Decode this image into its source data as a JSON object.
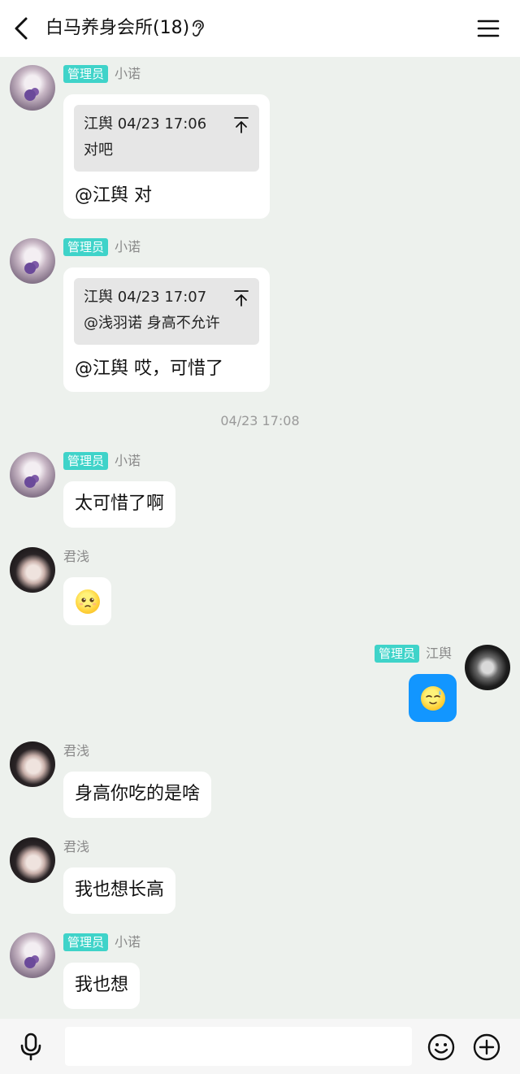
{
  "header": {
    "title": "白马养身会所(18)"
  },
  "badge_label": "管理员",
  "messages": [
    {
      "sender": "小诺",
      "quote_author": "江舆",
      "quote_time": "04/23 17:06",
      "quote_text": "对吧",
      "text": "@江舆 对"
    },
    {
      "sender": "小诺",
      "quote_author": "江舆",
      "quote_time": "04/23 17:07",
      "quote_text": "@浅羽诺 身高不允许",
      "text": "@江舆 哎，可惜了"
    },
    {
      "sender": "小诺",
      "text": "太可惜了啊"
    },
    {
      "sender": "君浅",
      "emoji": "pleading-face-icon"
    },
    {
      "sender": "江舆",
      "emoji": "sweat-smile-face-icon"
    },
    {
      "sender": "君浅",
      "text": "身高你吃的是啥"
    },
    {
      "sender": "君浅",
      "text": "我也想长高"
    },
    {
      "sender": "小诺",
      "text": "我也想"
    }
  ],
  "timestamp": "04/23 17:08",
  "input": {
    "value": "",
    "placeholder": ""
  },
  "colors": {
    "background": "#edf1ed",
    "badge": "#3fd3c9",
    "my_bubble": "#1296ff"
  }
}
